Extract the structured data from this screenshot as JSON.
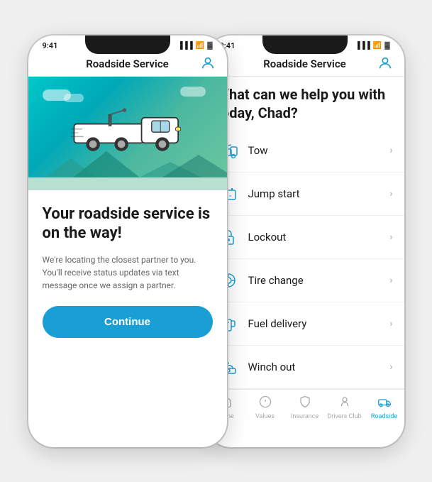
{
  "leftPhone": {
    "statusBar": {
      "time": "9:41"
    },
    "header": {
      "title": "Roadside Service"
    },
    "heroAlt": "Tow truck illustration",
    "mainHeading": "Your roadside service is on the way!",
    "subText": "We're locating the closest partner to you. You'll receive status updates via text message once we assign a partner.",
    "continueLabel": "Continue"
  },
  "rightPhone": {
    "statusBar": {
      "time": "9:41"
    },
    "header": {
      "title": "Roadside Service"
    },
    "greeting": "What can we help you with today, Chad?",
    "services": [
      {
        "id": "tow",
        "label": "Tow"
      },
      {
        "id": "jump-start",
        "label": "Jump start"
      },
      {
        "id": "lockout",
        "label": "Lockout"
      },
      {
        "id": "tire-change",
        "label": "Tire change"
      },
      {
        "id": "fuel-delivery",
        "label": "Fuel delivery"
      },
      {
        "id": "winch-out",
        "label": "Winch out"
      }
    ],
    "bottomNav": [
      {
        "id": "home",
        "label": "Home",
        "active": false
      },
      {
        "id": "values",
        "label": "Values",
        "active": false
      },
      {
        "id": "insurance",
        "label": "Insurance",
        "active": false
      },
      {
        "id": "drivers-club",
        "label": "Drivers Club",
        "active": false
      },
      {
        "id": "roadside",
        "label": "Roadside",
        "active": true
      }
    ]
  }
}
